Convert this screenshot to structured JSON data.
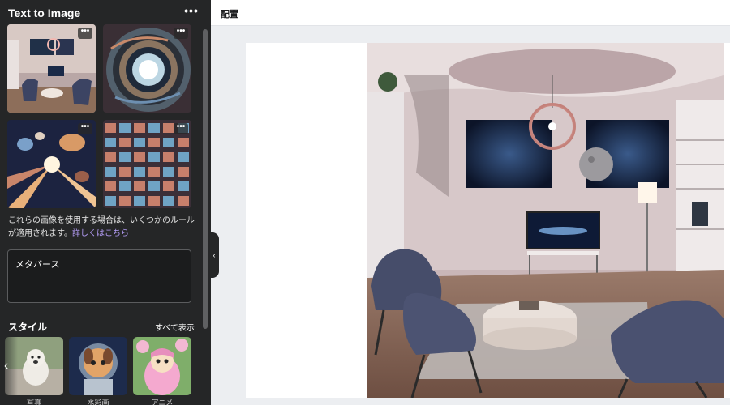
{
  "panel": {
    "title": "Text to Image",
    "more_icon": "more-horizontal-icon",
    "results": [
      {
        "name": "living-room-result",
        "more_label": "•••"
      },
      {
        "name": "vortex-result",
        "more_label": "•••"
      },
      {
        "name": "space-explosion-result",
        "more_label": "•••"
      },
      {
        "name": "mosaic-result",
        "more_label": "•••"
      }
    ],
    "notice_text": "これらの画像を使用する場合は、いくつかのルールが適用されます。",
    "notice_link": "詳しくはこちら",
    "prompt_value": "メタバース",
    "style_heading": "スタイル",
    "style_show_all": "すべて表示",
    "style_prev_icon": "chevron-left-icon",
    "styles": [
      {
        "caption": "写真"
      },
      {
        "caption": "水彩画"
      },
      {
        "caption": "アニメ"
      }
    ]
  },
  "topbar": {
    "label": "配置"
  },
  "collapse_icon": "chevron-left-icon",
  "colors": {
    "panel_bg": "#252627",
    "link": "#b39cf5",
    "canvas_bg": "#eceef1"
  }
}
